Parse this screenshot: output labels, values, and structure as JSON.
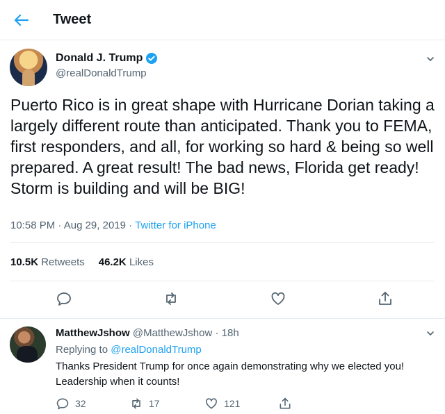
{
  "header": {
    "title": "Tweet",
    "back_icon": "back-arrow-icon"
  },
  "colors": {
    "accent": "#1da1f2",
    "text": "#0f1419",
    "muted": "#536471",
    "border": "#e6ecf0"
  },
  "tweet": {
    "author_name": "Donald J. Trump",
    "handle": "@realDonaldTrump",
    "verified": true,
    "text": "Puerto Rico is in great shape with Hurricane Dorian taking a largely different route than anticipated. Thank you to FEMA, first responders, and all, for working so hard & being so well prepared. A great result! The bad news, Florida get ready! Storm is building and will be BIG!",
    "time": "10:58 PM",
    "date": "Aug 29, 2019",
    "dot": "·",
    "source": "Twitter for iPhone",
    "retweets_count": "10.5K",
    "retweets_label": "Retweets",
    "likes_count": "46.2K",
    "likes_label": "Likes"
  },
  "reply": {
    "name": "MatthewJshow",
    "handle": "@MatthewJshow",
    "age": "18h",
    "dot": "·",
    "replying_prefix": "Replying to",
    "replying_to": "@realDonaldTrump",
    "text": "Thanks President Trump for once again demonstrating why we elected you! Leadership when it counts!",
    "reply_count": "32",
    "retweet_count": "17",
    "like_count": "121"
  }
}
